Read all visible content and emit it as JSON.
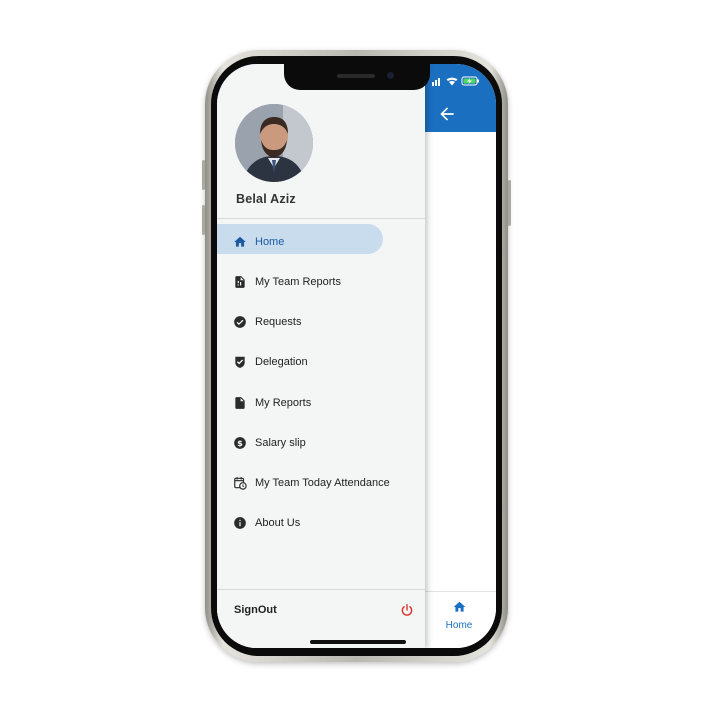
{
  "user": {
    "name": "Belal Aziz"
  },
  "menu": {
    "items": [
      {
        "label": "Home",
        "icon": "home-icon",
        "active": true
      },
      {
        "label": "My Team Reports",
        "icon": "report-file-icon"
      },
      {
        "label": "Requests",
        "icon": "check-circle-icon"
      },
      {
        "label": "Delegation",
        "icon": "shield-check-icon"
      },
      {
        "label": "My Reports",
        "icon": "file-icon"
      },
      {
        "label": "Salary slip",
        "icon": "dollar-circle-icon"
      },
      {
        "label": "My Team Today Attendance",
        "icon": "calendar-clock-icon"
      },
      {
        "label": "About Us",
        "icon": "info-icon"
      }
    ],
    "signout_label": "SignOut"
  },
  "bottom_nav": {
    "home_label": "Home"
  },
  "colors": {
    "primary": "#1b6fc0",
    "active_bg": "#c9dcee",
    "signout_icon": "#d9342b"
  }
}
